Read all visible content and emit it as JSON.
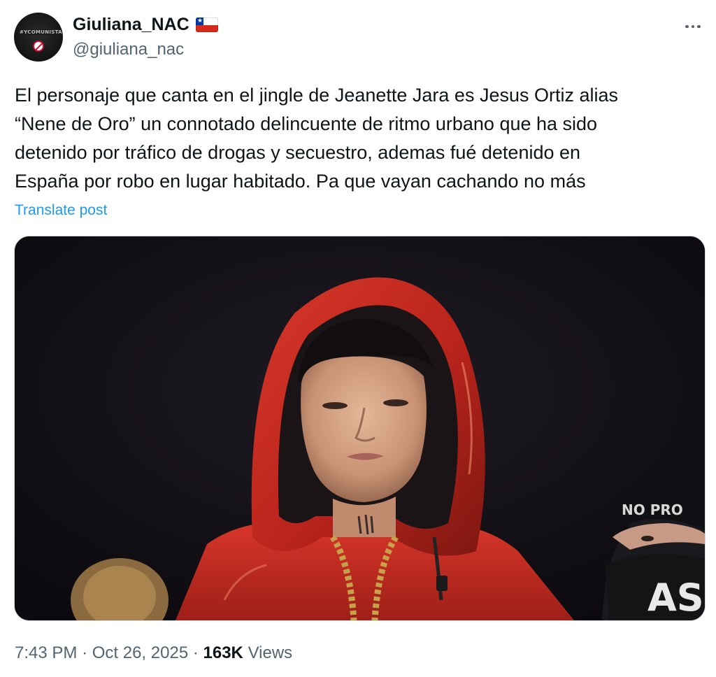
{
  "author": {
    "display_name": "Giuliana_NAC",
    "handle": "@giuliana_nac",
    "flag": "chile-flag-icon",
    "avatar_band_text": "#YCOMUNISTA"
  },
  "tweet": {
    "text": "El personaje que canta en el jingle de Jeanette Jara es Jesus Ortiz alias\n“Nene de Oro”  un connotado delincuente de ritmo urbano que ha sido\ndetenido por tráfico de drogas y secuestro, ademas fué detenido en\nEspaña por robo en lugar habitado.  Pa que vayan cachando no más",
    "translate_label": "Translate post"
  },
  "media": {
    "hood_text": "NO PRO",
    "mask_text": "AS"
  },
  "meta": {
    "time": "7:43 PM",
    "separator": "·",
    "date": "Oct 26, 2025",
    "views_count": "163K",
    "views_label": "Views"
  },
  "colors": {
    "text_primary": "#0f1419",
    "text_secondary": "#536471",
    "link": "#1d9bf0",
    "border": "#cfd9de",
    "jacket_red": "#c62a1f"
  },
  "icons": {
    "more": "more-horizontal-icon"
  }
}
